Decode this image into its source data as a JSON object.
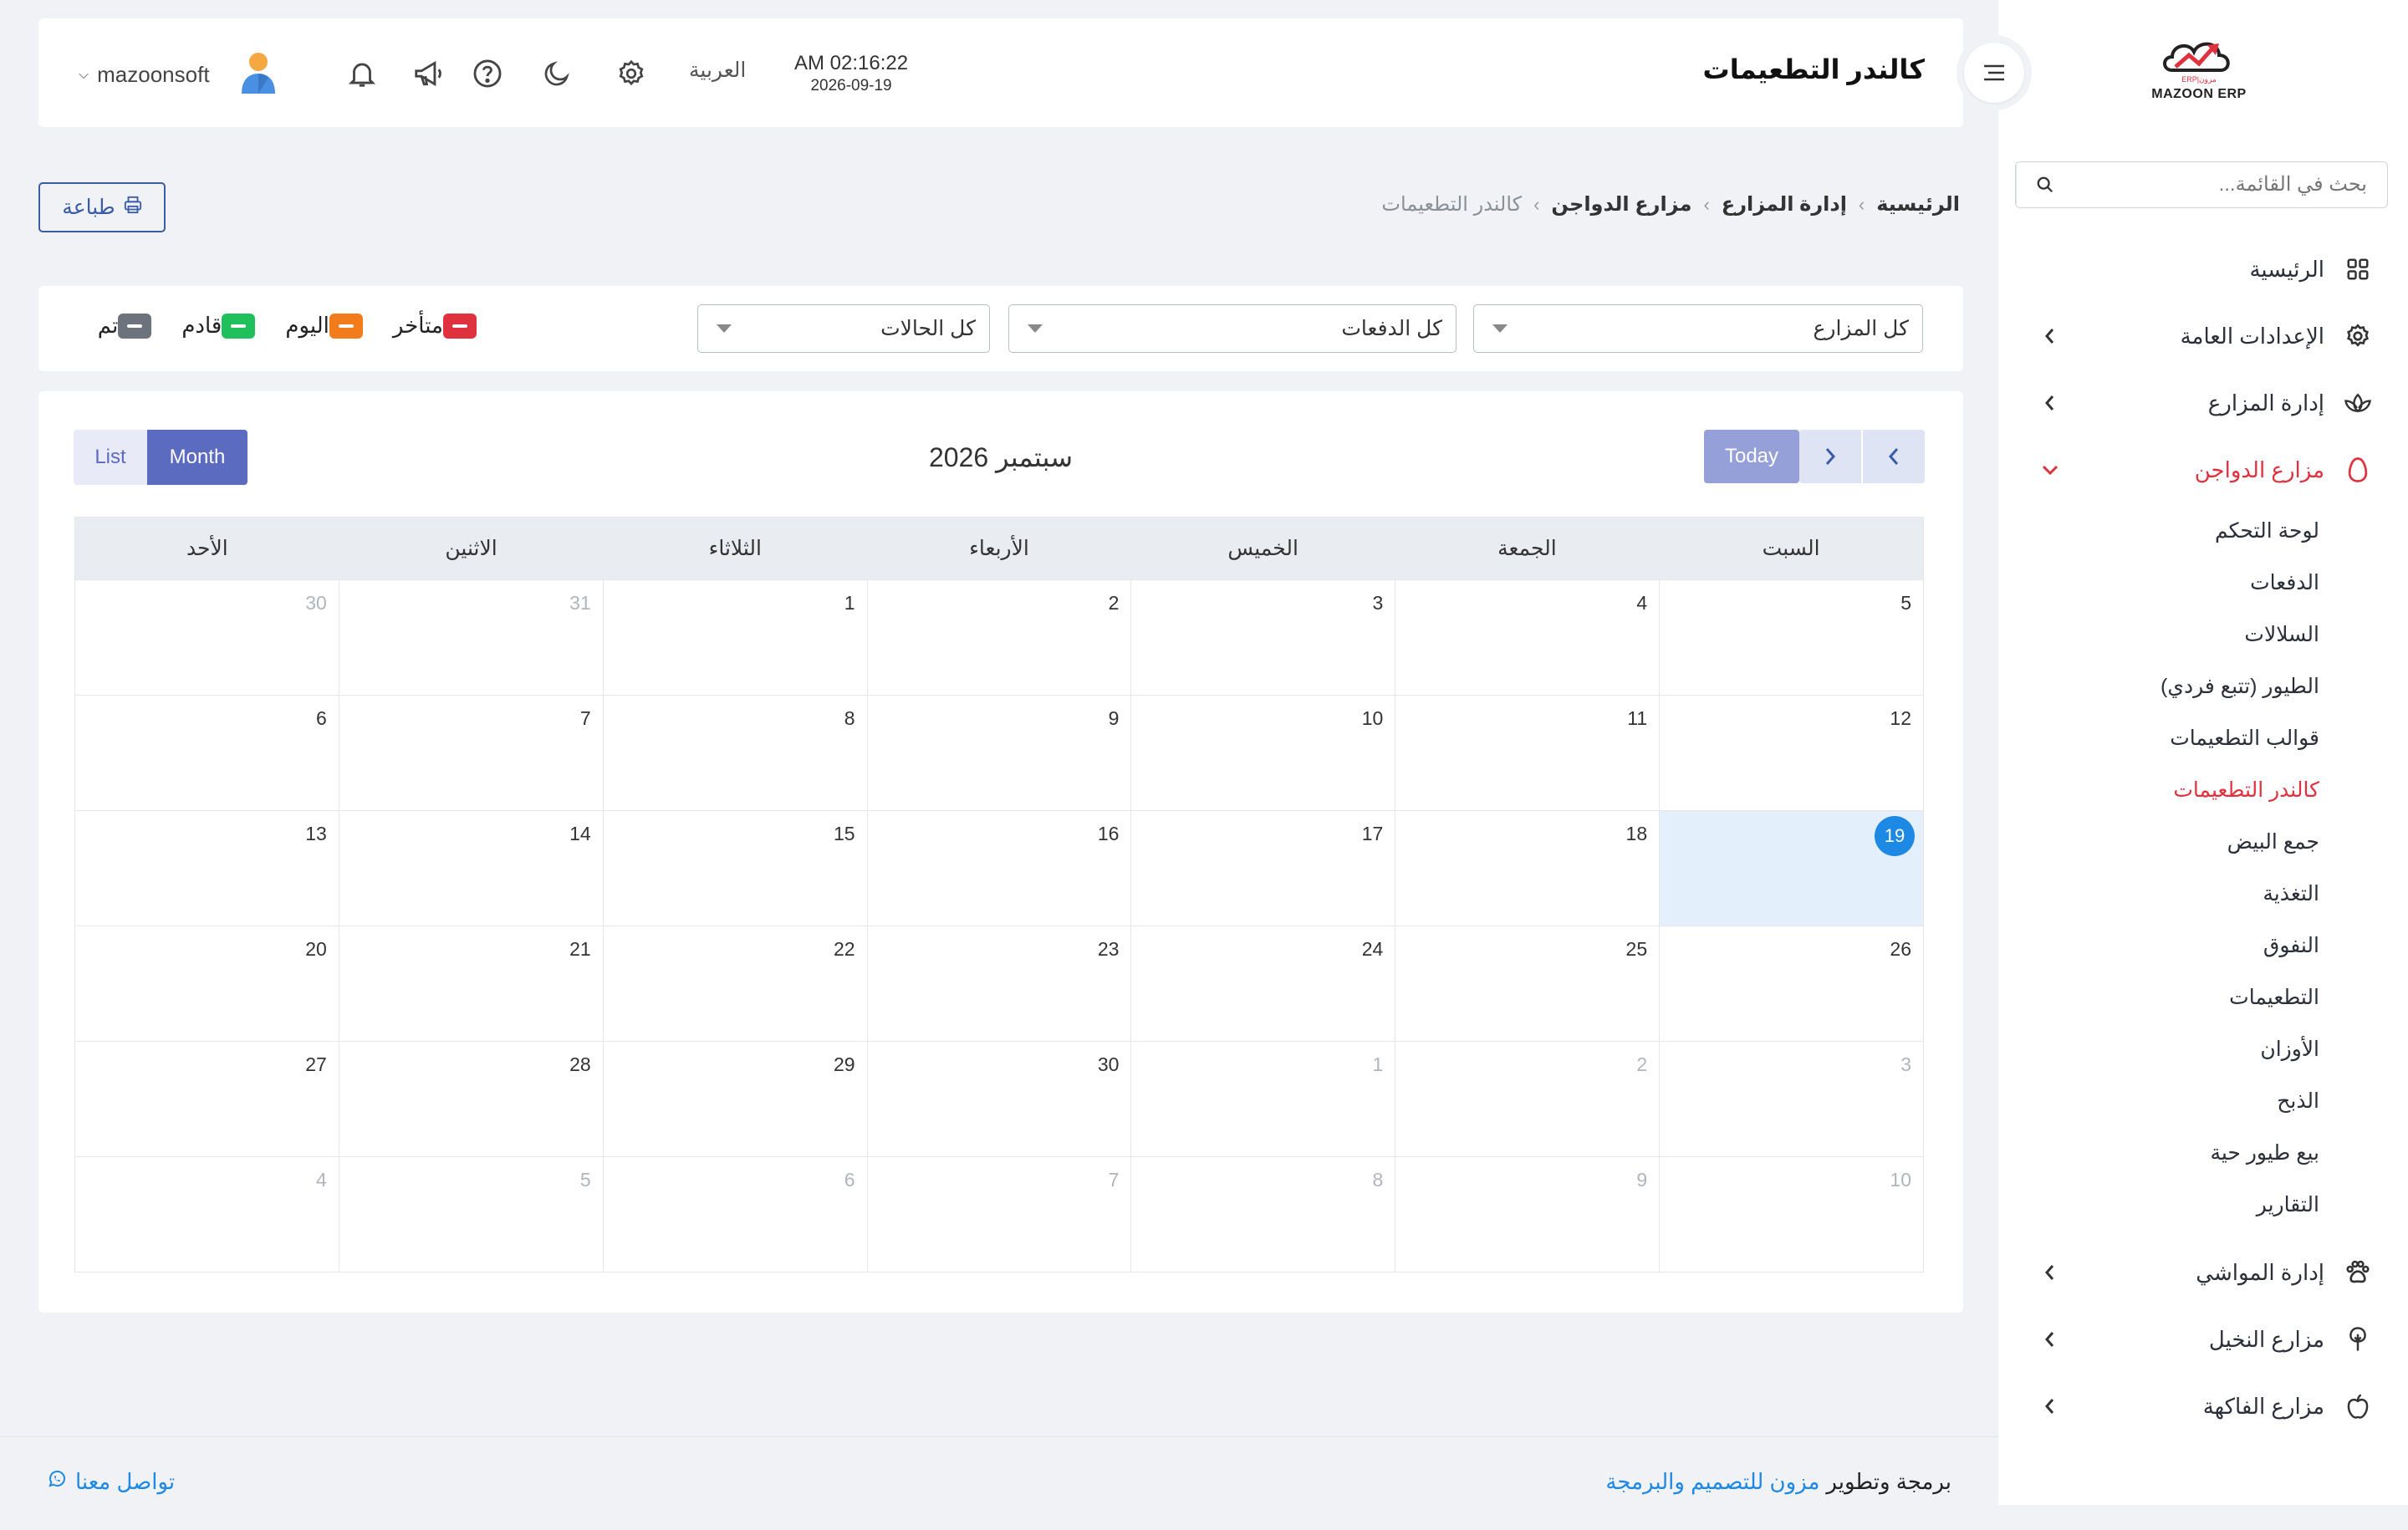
{
  "sidebar": {
    "logo_text": "MAZOON ERP",
    "logo_small": "ERP|مزون",
    "search_placeholder": "بحث في القائمة...",
    "items": [
      {
        "label": "الرئيسية",
        "icon": "grid-icon"
      },
      {
        "label": "الإعدادات العامة",
        "icon": "gear-icon"
      },
      {
        "label": "إدارة المزارع",
        "icon": "lotus-icon"
      },
      {
        "label": "مزارع الدواجن",
        "icon": "egg-icon"
      },
      {
        "label": "إدارة المواشي",
        "icon": "paw-icon"
      },
      {
        "label": "مزارع النخيل",
        "icon": "tree-icon"
      },
      {
        "label": "مزارع الفاكهة",
        "icon": "apple-icon"
      }
    ],
    "submenu": [
      "لوحة التحكم",
      "الدفعات",
      "السلالات",
      "الطيور (تتبع فردي)",
      "قوالب التطعيمات",
      "كالندر التطعيمات",
      "جمع البيض",
      "التغذية",
      "النفوق",
      "التطعيمات",
      "الأوزان",
      "الذبح",
      "بيع طيور حية",
      "التقارير"
    ],
    "active_submenu": "كالندر التطعيمات"
  },
  "header": {
    "title": "كالندر التطعيمات",
    "time": "AM 02:16:22",
    "date": "2026-09-19",
    "language": "العربية",
    "username": "mazoonsoft"
  },
  "breadcrumb": [
    "الرئيسية",
    "إدارة المزارع",
    "مزارع الدواجن",
    "كالندر التطعيمات"
  ],
  "print_label": "طباعة",
  "filters": {
    "farms": "كل المزارع",
    "batches": "كل الدفعات",
    "statuses": "كل الحالات"
  },
  "legend": [
    {
      "label": "متأخر",
      "color": "#e0313f"
    },
    {
      "label": "اليوم",
      "color": "#f27b1c"
    },
    {
      "label": "قادم",
      "color": "#1fbf5b"
    },
    {
      "label": "تم",
      "color": "#6c737c"
    }
  ],
  "calendar": {
    "month_title": "سبتمبر 2026",
    "today_label": "Today",
    "view_month": "Month",
    "view_list": "List",
    "weekdays": [
      "السبت",
      "الجمعة",
      "الخميس",
      "الأربعاء",
      "الثلاثاء",
      "الاثنين",
      "الأحد"
    ],
    "today": "19",
    "weeks": [
      [
        {
          "n": "5"
        },
        {
          "n": "4"
        },
        {
          "n": "3"
        },
        {
          "n": "2"
        },
        {
          "n": "1"
        },
        {
          "n": "31",
          "o": true
        },
        {
          "n": "30",
          "o": true
        }
      ],
      [
        {
          "n": "12"
        },
        {
          "n": "11"
        },
        {
          "n": "10"
        },
        {
          "n": "9"
        },
        {
          "n": "8"
        },
        {
          "n": "7"
        },
        {
          "n": "6"
        }
      ],
      [
        {
          "n": "19",
          "t": true
        },
        {
          "n": "18"
        },
        {
          "n": "17"
        },
        {
          "n": "16"
        },
        {
          "n": "15"
        },
        {
          "n": "14"
        },
        {
          "n": "13"
        }
      ],
      [
        {
          "n": "26"
        },
        {
          "n": "25"
        },
        {
          "n": "24"
        },
        {
          "n": "23"
        },
        {
          "n": "22"
        },
        {
          "n": "21"
        },
        {
          "n": "20"
        }
      ],
      [
        {
          "n": "3",
          "o": true
        },
        {
          "n": "2",
          "o": true
        },
        {
          "n": "1",
          "o": true
        },
        {
          "n": "30"
        },
        {
          "n": "29"
        },
        {
          "n": "28"
        },
        {
          "n": "27"
        }
      ],
      [
        {
          "n": "10",
          "o": true
        },
        {
          "n": "9",
          "o": true
        },
        {
          "n": "8",
          "o": true
        },
        {
          "n": "7",
          "o": true
        },
        {
          "n": "6",
          "o": true
        },
        {
          "n": "5",
          "o": true
        },
        {
          "n": "4",
          "o": true
        }
      ]
    ]
  },
  "footer": {
    "dev_prefix": "برمجة وتطوير",
    "dev_link": "مزون للتصميم والبرمجة",
    "contact": "تواصل معنا"
  }
}
